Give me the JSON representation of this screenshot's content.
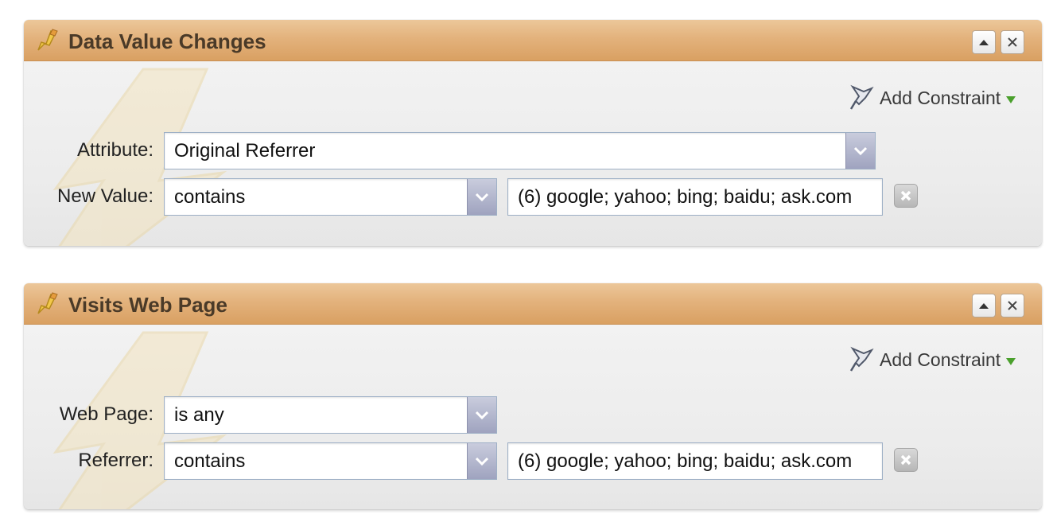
{
  "panels": [
    {
      "title": "Data Value Changes",
      "add_constraint": "Add Constraint",
      "rows": [
        {
          "label": "Attribute:",
          "select_value": "Original Referrer"
        },
        {
          "label": "New Value:",
          "select_value": "contains",
          "input_value": "(6) google; yahoo; bing; baidu; ask.com"
        }
      ]
    },
    {
      "title": "Visits Web Page",
      "add_constraint": "Add Constraint",
      "rows": [
        {
          "label": "Web Page:",
          "select_value": "is any"
        },
        {
          "label": "Referrer:",
          "select_value": "contains",
          "input_value": "(6) google; yahoo; bing; baidu; ask.com"
        }
      ]
    }
  ],
  "icons": {
    "header": "pencil-lightning-icon",
    "collapse": "collapse-icon",
    "close": "close-icon",
    "add_constraint": "pushpin-icon",
    "add_arrow": "green-triangle-down-icon",
    "dropdown": "chevron-down-icon",
    "remove": "remove-x-icon"
  },
  "colors": {
    "header_top": "#ecc79a",
    "header_bottom": "#d9a062",
    "title_text": "#4a3a28",
    "panel_body": "#efefef",
    "dropdown_button": "#a4a8c4",
    "add_arrow": "#4aa02c"
  }
}
